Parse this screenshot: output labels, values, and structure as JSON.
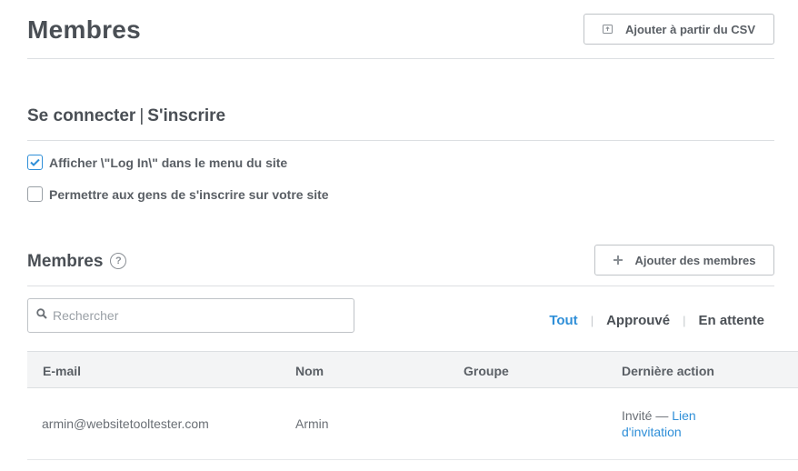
{
  "header": {
    "title": "Membres",
    "csv_button": "Ajouter à partir du CSV"
  },
  "login": {
    "title_left": "Se connecter",
    "separator": "|",
    "title_right": "S'inscrire",
    "options": [
      {
        "label": "Afficher \\\"Log In\\\" dans le menu du site",
        "checked": true
      },
      {
        "label": "Permettre aux gens de s'inscrire sur votre site",
        "checked": false
      }
    ]
  },
  "members": {
    "title": "Membres",
    "help_icon": "?",
    "add_button": "Ajouter des membres",
    "search_placeholder": "Rechercher",
    "filters": [
      "Tout",
      "Approuvé",
      "En attente"
    ],
    "active_filter": "Tout"
  },
  "table": {
    "columns": [
      "E-mail",
      "Nom",
      "Groupe",
      "Dernière action"
    ],
    "rows": [
      {
        "email": "armin@websitetooltester.com",
        "name": "Armin",
        "group": "",
        "action_prefix": "Invité —",
        "action_link_1": "Lien",
        "action_link_2": "d'invitation"
      }
    ]
  },
  "colors": {
    "accent": "#2f8fd8",
    "text": "#4a4f55",
    "border": "#dcdfe2"
  },
  "icons": {
    "csv": "upload-icon",
    "add": "plus-icon",
    "search": "search-icon",
    "check": "checkmark-icon",
    "help": "question-circle-icon"
  }
}
